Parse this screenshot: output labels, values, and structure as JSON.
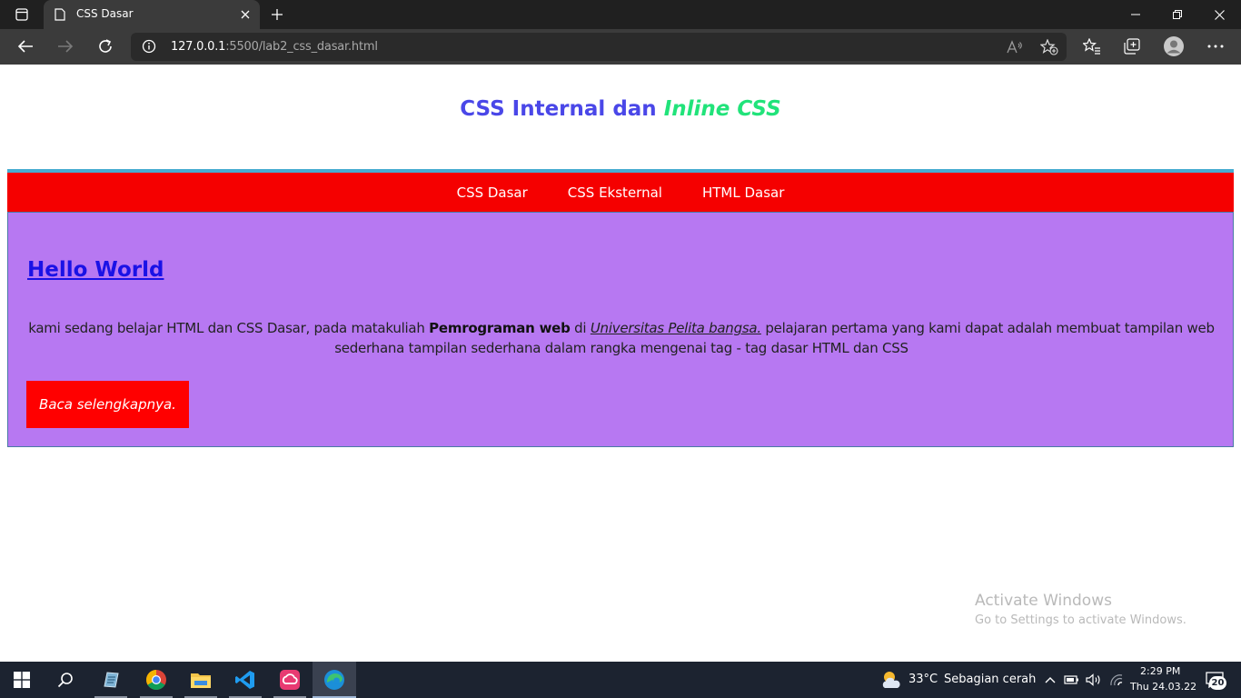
{
  "browser": {
    "tab_title": "CSS Dasar",
    "url_host": "127.0.0.1",
    "url_path": ":5500/lab2_css_dasar.html"
  },
  "page": {
    "title_main": "CSS Internal dan ",
    "title_em": "Inline CSS",
    "nav": [
      "CSS Dasar",
      "CSS Eksternal",
      "HTML Dasar"
    ],
    "heading": "Hello World",
    "para_part1": "kami sedang belajar HTML dan CSS Dasar, pada matakuliah ",
    "para_bold": "Pemrograman web",
    "para_part2": " di ",
    "para_link": "Universitas Pelita bangsa.",
    "para_part3": " pelajaran pertama yang kami dapat adalah membuat tampilan web sederhana tampilan sederhana dalam rangka mengenai tag - tag dasar HTML dan CSS",
    "button": "Baca selengkapnya."
  },
  "watermark": {
    "title": "Activate Windows",
    "subtitle": "Go to Settings to activate Windows."
  },
  "taskbar": {
    "weather_temp": "33°C",
    "weather_desc": "Sebagian cerah",
    "time": "2:29 PM",
    "date": "Thu 24.03.22",
    "notifications": "20"
  },
  "colors": {
    "title_blue": "#4a47e8",
    "title_green": "#21e37a",
    "nav_red": "#f50000",
    "nav_border": "#48acd1",
    "content_purple": "#b778f2",
    "button_red": "#ff0000"
  }
}
